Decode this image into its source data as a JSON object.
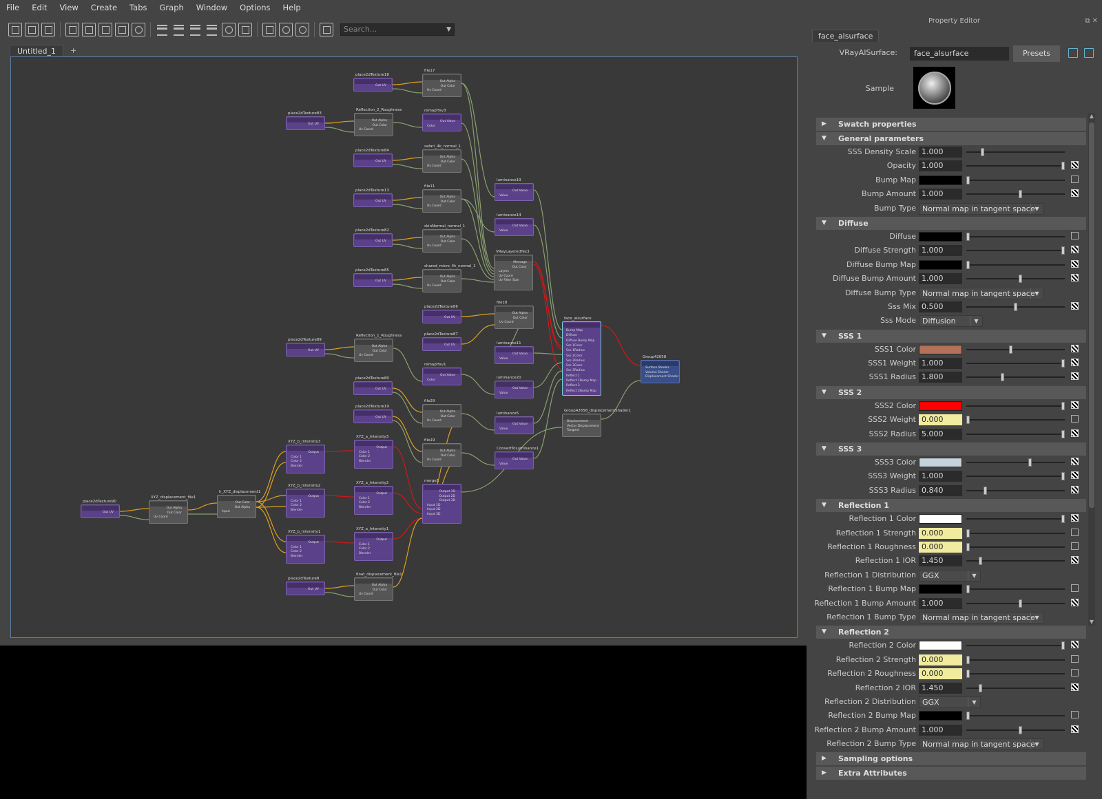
{
  "menubar": [
    "File",
    "Edit",
    "View",
    "Create",
    "Tabs",
    "Graph",
    "Window",
    "Options",
    "Help"
  ],
  "toolbar": {
    "search_placeholder": "Search..."
  },
  "tabs": {
    "active": "Untitled_1",
    "add": "+"
  },
  "graph": {
    "nodes": [
      {
        "title": "place2dTexture18",
        "kind": "p2d"
      },
      {
        "title": "file17",
        "kind": "file"
      },
      {
        "title": "place2dTexture83",
        "kind": "p2d"
      },
      {
        "title": "Reflection_2_Roughness",
        "kind": "file"
      },
      {
        "title": "remapHsv3",
        "kind": "remap"
      },
      {
        "title": "place2dTexture84",
        "kind": "p2d"
      },
      {
        "title": "safari_4k_normal_1",
        "kind": "file"
      },
      {
        "title": "place2dTexture13",
        "kind": "p2d"
      },
      {
        "title": "file11",
        "kind": "file"
      },
      {
        "title": "place2dTexture82",
        "kind": "p2d"
      },
      {
        "title": "skinNormal_normal_1",
        "kind": "file"
      },
      {
        "title": "place2dTexture85",
        "kind": "p2d"
      },
      {
        "title": "shared_micro_4k_normal_1",
        "kind": "file"
      },
      {
        "title": "place2dTexture86",
        "kind": "p2d"
      },
      {
        "title": "place2dTexture89",
        "kind": "p2d"
      },
      {
        "title": "Reflection_1_Roughness",
        "kind": "file"
      },
      {
        "title": "place2dTexture87",
        "kind": "p2d"
      },
      {
        "title": "remapHsv1",
        "kind": "remap"
      },
      {
        "title": "place2dTexture80",
        "kind": "p2d"
      },
      {
        "title": "file29",
        "kind": "file"
      },
      {
        "title": "place2dTexture19",
        "kind": "p2d"
      },
      {
        "title": "file19",
        "kind": "file"
      },
      {
        "title": "luminance19",
        "kind": "lum"
      },
      {
        "title": "luminance14",
        "kind": "lum"
      },
      {
        "title": "VRayLayeredTex3",
        "kind": "layered"
      },
      {
        "title": "file18",
        "kind": "file"
      },
      {
        "title": "luminance11",
        "kind": "lum"
      },
      {
        "title": "luminance20",
        "kind": "lum"
      },
      {
        "title": "luminance5",
        "kind": "lum"
      },
      {
        "title": "ConvertToLuminance1",
        "kind": "lum"
      },
      {
        "title": "merge1",
        "kind": "merge"
      },
      {
        "title": "face_alsurface",
        "kind": "shader"
      },
      {
        "title": "Group42658",
        "kind": "sg"
      },
      {
        "title": "Group42658_displacementShader1",
        "kind": "disp"
      },
      {
        "title": "place2dTexture90",
        "kind": "p2d"
      },
      {
        "title": "XYZ_displacement_file1",
        "kind": "file"
      },
      {
        "title": "h_XYZ_displacement1",
        "kind": "file"
      },
      {
        "title": "XYZ_b_Intensity3",
        "kind": "blend"
      },
      {
        "title": "XYZ_b_Intensity2",
        "kind": "blend"
      },
      {
        "title": "XYZ_b_Intensity1",
        "kind": "blend"
      },
      {
        "title": "XYZ_a_Intensity3",
        "kind": "blend"
      },
      {
        "title": "XYZ_a_Intensity2",
        "kind": "blend"
      },
      {
        "title": "XYZ_a_Intensity1",
        "kind": "blend"
      },
      {
        "title": "place2dTexture8",
        "kind": "p2d"
      },
      {
        "title": "float_displacement_file1",
        "kind": "file"
      }
    ],
    "port_labels": {
      "uv": "Out UV",
      "alpha": "Out Alpha",
      "color": "Out Color",
      "coord": "Uv Coord",
      "value": "Out Value",
      "val_in": "Value",
      "color_in": "Color",
      "layers": "Layers",
      "filter": "Uv Filter Size",
      "message": "Message",
      "output": "Output",
      "c1": "Color 1",
      "c2": "Color 2",
      "blender": "Blender",
      "input": "Input",
      "o1": "Output 1D",
      "o2": "Output 2D",
      "o3": "Output 3D",
      "i1": "Input 1D",
      "i2": "Input 2D",
      "i3": "Input 3D",
      "surface": "Surface Shader",
      "volume": "Volume Shader",
      "dispsh": "Displacement Shader",
      "disp": "Displacement",
      "vdisp": "Vector Displacement",
      "tangent": "Tangent"
    },
    "shader_ports": [
      "Bump Map",
      "Diffuse",
      "Diffuse Bump Map",
      "Sss 1Color",
      "Sss 1Radius",
      "Sss 2Color",
      "Sss 2Radius",
      "Sss 3Color",
      "Sss 3Radius",
      "Reflect 1",
      "Reflect 1Bump Map",
      "Reflect 2",
      "Reflect 2Bump Map"
    ]
  },
  "property_editor": {
    "title": "Property Editor",
    "tab": "face_alsurface",
    "type_label": "VRayAlSurface:",
    "type_value": "face_alsurface",
    "presets": "Presets",
    "sample_label": "Sample",
    "sections": [
      {
        "title": "Swatch properties",
        "open": false,
        "rows": []
      },
      {
        "title": "General parameters",
        "open": true,
        "rows": [
          {
            "label": "SSS Density Scale",
            "kind": "num",
            "value": "1.000",
            "slider": 0.15
          },
          {
            "label": "Opacity",
            "kind": "num",
            "value": "1.000",
            "slider": 1.0,
            "map": true
          },
          {
            "label": "Bump Map",
            "kind": "swatch",
            "color": "#000000",
            "slider": 0.0,
            "arrow": true
          },
          {
            "label": "Bump Amount",
            "kind": "num",
            "value": "1.000",
            "slider": 0.55,
            "map": true
          },
          {
            "label": "Bump Type",
            "kind": "drop",
            "value": "Normal map in tangent space"
          }
        ]
      },
      {
        "title": "Diffuse",
        "open": true,
        "rows": [
          {
            "label": "Diffuse",
            "kind": "swatch",
            "color": "#000000",
            "slider": 0.0,
            "arrow": true
          },
          {
            "label": "Diffuse Strength",
            "kind": "num",
            "value": "1.000",
            "slider": 1.0,
            "map": true
          },
          {
            "label": "Diffuse Bump Map",
            "kind": "swatch",
            "color": "#000000",
            "slider": 0.0,
            "map": true
          },
          {
            "label": "Diffuse Bump Amount",
            "kind": "num",
            "value": "1.000",
            "slider": 0.55,
            "map": true
          },
          {
            "label": "Diffuse Bump Type",
            "kind": "drop",
            "value": "Normal map in tangent space"
          },
          {
            "label": "Sss Mix",
            "kind": "num",
            "value": "0.500",
            "slider": 0.5,
            "map": true
          },
          {
            "label": "Sss Mode",
            "kind": "drop_s",
            "value": "Diffusion"
          }
        ]
      },
      {
        "title": "SSS 1",
        "open": true,
        "rows": [
          {
            "label": "SSS1 Color",
            "kind": "swatch",
            "color": "#b47158",
            "slider": 0.45,
            "map": true
          },
          {
            "label": "SSS1 Weight",
            "kind": "num",
            "value": "1.000",
            "slider": 1.0,
            "map": true
          },
          {
            "label": "SSS1 Radius",
            "kind": "num",
            "value": "1.800",
            "slider": 0.36,
            "map": true
          }
        ]
      },
      {
        "title": "SSS 2",
        "open": true,
        "rows": [
          {
            "label": "SSS2 Color",
            "kind": "swatch",
            "color": "#ff0000",
            "slider": 1.0,
            "map": true
          },
          {
            "label": "SSS2 Weight",
            "kind": "num_y",
            "value": "0.000",
            "slider": 0.0,
            "arrow": true
          },
          {
            "label": "SSS2 Radius",
            "kind": "num",
            "value": "5.000",
            "slider": 1.0,
            "map": true
          }
        ]
      },
      {
        "title": "SSS 3",
        "open": true,
        "rows": [
          {
            "label": "SSS3 Color",
            "kind": "swatch",
            "color": "#c5d4dc",
            "slider": 0.65,
            "map": true
          },
          {
            "label": "SSS3 Weight",
            "kind": "num",
            "value": "1.000",
            "slider": 1.0,
            "map": true
          },
          {
            "label": "SSS3 Radius",
            "kind": "num",
            "value": "0.840",
            "slider": 0.18,
            "map": true
          }
        ]
      },
      {
        "title": "Reflection 1",
        "open": true,
        "rows": [
          {
            "label": "Reflection 1 Color",
            "kind": "swatch",
            "color": "#ffffff",
            "slider": 1.0,
            "map": true
          },
          {
            "label": "Reflection 1 Strength",
            "kind": "num_y",
            "value": "0.000",
            "slider": 0.0,
            "arrow": true
          },
          {
            "label": "Reflection 1 Roughness",
            "kind": "num_y",
            "value": "0.000",
            "slider": 0.0,
            "arrow": true
          },
          {
            "label": "Reflection 1 IOR",
            "kind": "num",
            "value": "1.450",
            "slider": 0.13,
            "map": true
          },
          {
            "label": "Reflection 1 Distribution",
            "kind": "drop_s",
            "value": "GGX"
          },
          {
            "label": "Reflection 1 Bump Map",
            "kind": "swatch",
            "color": "#000000",
            "slider": 0.0,
            "arrow": true
          },
          {
            "label": "Reflection 1 Bump Amount",
            "kind": "num",
            "value": "1.000",
            "slider": 0.55,
            "map": true
          },
          {
            "label": "Reflection 1 Bump Type",
            "kind": "drop",
            "value": "Normal map in tangent space"
          }
        ]
      },
      {
        "title": "Reflection 2",
        "open": true,
        "rows": [
          {
            "label": "Reflection 2 Color",
            "kind": "swatch",
            "color": "#ffffff",
            "slider": 1.0,
            "map": true
          },
          {
            "label": "Reflection 2 Strength",
            "kind": "num_y",
            "value": "0.000",
            "slider": 0.0,
            "arrow": true
          },
          {
            "label": "Reflection 2 Roughness",
            "kind": "num_y",
            "value": "0.000",
            "slider": 0.0,
            "arrow": true
          },
          {
            "label": "Reflection 2 IOR",
            "kind": "num",
            "value": "1.450",
            "slider": 0.13,
            "map": true
          },
          {
            "label": "Reflection 2 Distribution",
            "kind": "drop_s",
            "value": "GGX"
          },
          {
            "label": "Reflection 2 Bump Map",
            "kind": "swatch",
            "color": "#000000",
            "slider": 0.0,
            "arrow": true
          },
          {
            "label": "Reflection 2 Bump Amount",
            "kind": "num",
            "value": "1.000",
            "slider": 0.55,
            "map": true
          },
          {
            "label": "Reflection 2 Bump Type",
            "kind": "drop",
            "value": "Normal map in tangent space"
          }
        ]
      },
      {
        "title": "Sampling options",
        "open": false,
        "rows": []
      },
      {
        "title": "Extra Attributes",
        "open": false,
        "rows": []
      }
    ]
  },
  "colors": {
    "accent": "#5c7ea3",
    "purple_node": "#5b4189",
    "selected": "#6fd2d0",
    "yellow_field": "#f0eb9e",
    "wire_orange": "#e0a020",
    "wire_green": "#8aa070",
    "wire_red": "#d01818"
  }
}
